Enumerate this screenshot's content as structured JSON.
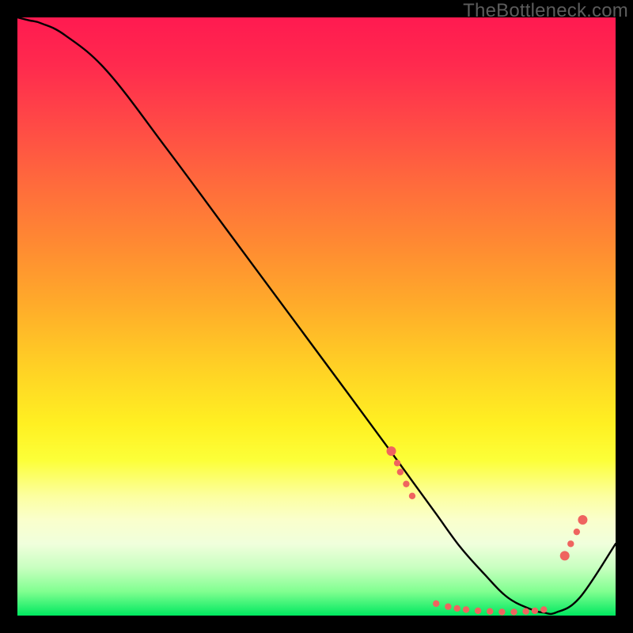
{
  "watermark": {
    "text": "TheBottleneck.com"
  },
  "chart_data": {
    "type": "line",
    "title": "",
    "xlabel": "",
    "ylabel": "",
    "xlim": [
      0,
      100
    ],
    "ylim": [
      0,
      100
    ],
    "grid": false,
    "series": [
      {
        "name": "curve",
        "color": "#000000",
        "x": [
          0,
          2,
          4,
          8,
          15,
          25,
          35,
          45,
          55,
          62,
          66,
          70,
          74,
          78,
          82,
          86,
          88,
          90,
          94,
          100
        ],
        "y": [
          100,
          99.5,
          99,
          97,
          91,
          78,
          64.5,
          51,
          37.5,
          28,
          22.5,
          17,
          11.5,
          7,
          3,
          1,
          0.5,
          0.5,
          3,
          12
        ]
      }
    ],
    "markers": {
      "color": "#ef645f",
      "radius_primary": 6,
      "radius_secondary": 4.2,
      "points": [
        {
          "x": 62.5,
          "y": 27.5,
          "r": "primary"
        },
        {
          "x": 63.5,
          "y": 25.5,
          "r": "secondary"
        },
        {
          "x": 64.0,
          "y": 24.0,
          "r": "secondary"
        },
        {
          "x": 65.0,
          "y": 22.0,
          "r": "secondary"
        },
        {
          "x": 66.0,
          "y": 20.0,
          "r": "secondary"
        },
        {
          "x": 70.0,
          "y": 2.0,
          "r": "secondary"
        },
        {
          "x": 72.0,
          "y": 1.5,
          "r": "secondary"
        },
        {
          "x": 73.5,
          "y": 1.2,
          "r": "secondary"
        },
        {
          "x": 75.0,
          "y": 1.0,
          "r": "secondary"
        },
        {
          "x": 77.0,
          "y": 0.8,
          "r": "secondary"
        },
        {
          "x": 79.0,
          "y": 0.7,
          "r": "secondary"
        },
        {
          "x": 81.0,
          "y": 0.6,
          "r": "secondary"
        },
        {
          "x": 83.0,
          "y": 0.6,
          "r": "secondary"
        },
        {
          "x": 85.0,
          "y": 0.7,
          "r": "secondary"
        },
        {
          "x": 86.5,
          "y": 0.8,
          "r": "secondary"
        },
        {
          "x": 88.0,
          "y": 1.0,
          "r": "secondary"
        },
        {
          "x": 91.5,
          "y": 10.0,
          "r": "primary"
        },
        {
          "x": 92.5,
          "y": 12.0,
          "r": "secondary"
        },
        {
          "x": 93.5,
          "y": 14.0,
          "r": "secondary"
        },
        {
          "x": 94.5,
          "y": 16.0,
          "r": "primary"
        }
      ]
    }
  }
}
